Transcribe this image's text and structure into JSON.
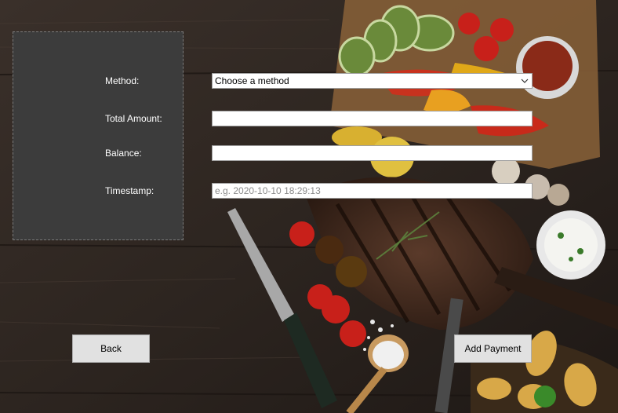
{
  "form": {
    "method_label": "Method:",
    "method_value": "Choose a method",
    "total_amount_label": "Total Amount:",
    "total_amount_value": "",
    "balance_label": "Balance:",
    "balance_value": "",
    "timestamp_label": "Timestamp:",
    "timestamp_placeholder": "e.g. 2020-10-10 18:29:13"
  },
  "buttons": {
    "back_label": "Back",
    "add_payment_label": "Add Payment"
  },
  "background": {
    "description_icon": "food-photo",
    "wood_color": "#3b2f28"
  }
}
